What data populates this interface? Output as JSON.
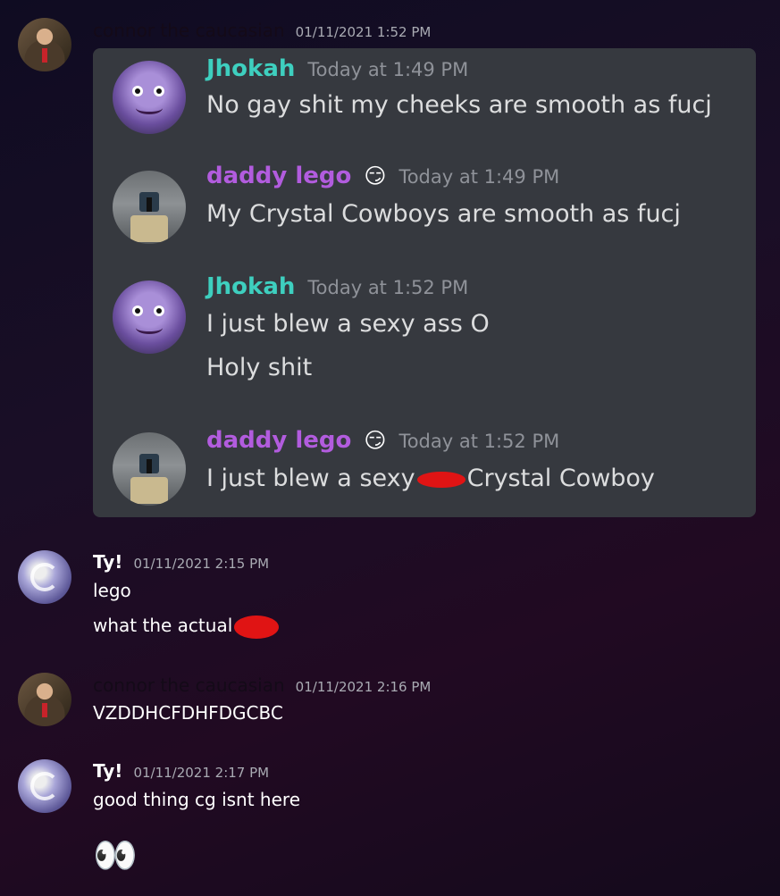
{
  "messages": [
    {
      "username": "connor the caucasian",
      "timestamp": "01/11/2021 1:52 PM",
      "quoted": [
        {
          "username": "Jhokah",
          "timestamp": "Today at 1:49 PM",
          "lines": [
            "No gay shit my cheeks are smooth as fucj"
          ]
        },
        {
          "username": "daddy lego",
          "emoji": "😏",
          "timestamp": "Today at 1:49 PM",
          "lines": [
            "My Crystal Cowboys are smooth as fucj"
          ]
        },
        {
          "username": "Jhokah",
          "timestamp": "Today at 1:52 PM",
          "lines": [
            "I just blew a sexy ass O",
            "Holy shit"
          ]
        },
        {
          "username": "daddy lego",
          "emoji": "😏",
          "timestamp": "Today at 1:52 PM",
          "lines": [
            "I just blew a sexy",
            "Crystal Cowboy"
          ]
        }
      ]
    },
    {
      "username": "Ty!",
      "timestamp": "01/11/2021 2:15 PM",
      "lines": [
        "lego",
        "what the actual"
      ]
    },
    {
      "username": "connor the caucasian",
      "timestamp": "01/11/2021 2:16 PM",
      "lines": [
        "VZDDHCFDHFDGCBC"
      ]
    },
    {
      "username": "Ty!",
      "timestamp": "01/11/2021 2:17 PM",
      "lines": [
        "good thing cg isnt here"
      ],
      "emoji": "👀"
    }
  ]
}
